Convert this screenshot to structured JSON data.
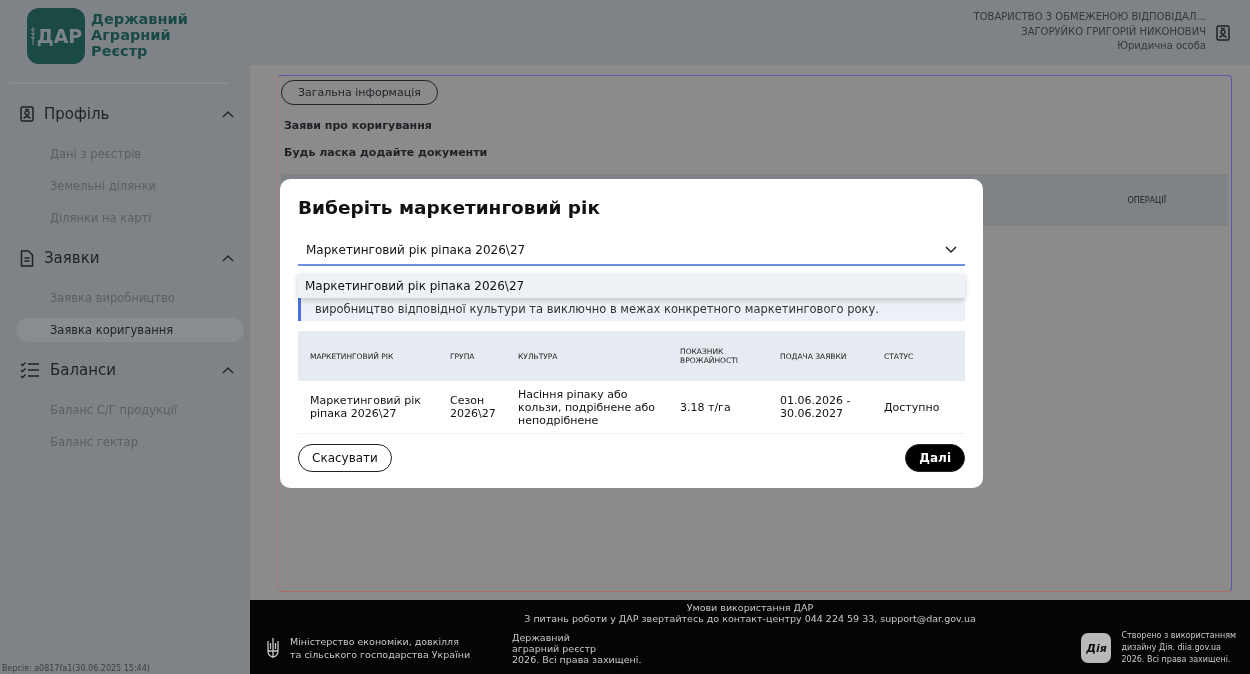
{
  "logo": {
    "mark": "ДАР",
    "lines": [
      "Державний",
      "Аграрний",
      "Реєстр"
    ]
  },
  "sidebar": {
    "sections": [
      {
        "title": "Профіль",
        "expanded": true,
        "items": [
          {
            "label": "Дані з реєстрів",
            "selected": false
          },
          {
            "label": "Земельні ділянки",
            "selected": false
          },
          {
            "label": "Ділянки на карті",
            "selected": false
          }
        ]
      },
      {
        "title": "Заявки",
        "expanded": true,
        "items": [
          {
            "label": "Заявка виробництво",
            "selected": false
          },
          {
            "label": "Заявка коригування",
            "selected": true
          }
        ]
      },
      {
        "title": "Баланси",
        "expanded": true,
        "items": [
          {
            "label": "Баланс С/Г продукції",
            "selected": false
          },
          {
            "label": "Баланс гектар",
            "selected": false
          }
        ]
      }
    ],
    "version": "Версія: a0817fa1(30.06.2025 15:44)"
  },
  "user": {
    "organization": "ТОВАРИСТВО З ОБМЕЖЕНОЮ ВІДПОВІДАЛ...",
    "name": "ЗАГОРУЙКО ГРИГОРІЙ НИКОНОВИЧ",
    "role": "Юридична особа"
  },
  "page": {
    "tab": "Загальна інформація",
    "heading": "Заяви про коригування",
    "subheading": "Будь ласка додайте документи",
    "table_column": "ОПЕРАЦІЇ"
  },
  "modal": {
    "title": "Виберіть маркетинговий рік",
    "select": {
      "value": "Маркетинговий рік ріпака 2026\\27",
      "expanded": true,
      "options": [
        {
          "label": "Маркетинговий рік ріпака 2026\\27",
          "selected": true
        }
      ]
    },
    "notice": "виробництво відповідної культури та виключно в межах конкретного маркетингового року.",
    "table": {
      "columns": [
        "МАРКЕТИНГОВИЙ РІК",
        "ГРУПА",
        "КУЛЬТУРА",
        "ПОКАЗНИК ВРОЖАЙНОСТІ",
        "ПОДАЧА ЗАЯВКИ",
        "СТАТУС"
      ],
      "rows": [
        [
          "Маркетинговий рік ріпака 2026\\27",
          "Сезон 2026\\27",
          "Насіння ріпаку або кользи, подрібнене або неподрібнене",
          "3.18 т/га",
          "01.06.2026 - 30.06.2027",
          "Доступно"
        ]
      ]
    },
    "cancel_button": "Скасувати",
    "next_button": "Далі"
  },
  "footer": {
    "terms": "Умови використання ДАР",
    "contact": "З питань роботи у ДАР звертайтесь до контакт-центру 044 224 59 33, support@dar.gov.ua",
    "ministry": [
      "Міністерство економіки, довкілля",
      "та сільського господарства України"
    ],
    "registry": [
      "Державний",
      "аграрний реєстр",
      "2026. Всі права захищені."
    ],
    "diia_logo": "Дія",
    "credit": [
      "Створено з використанням",
      "дизайну Дія. diia.gov.ua",
      "2026. Всі права захищені."
    ]
  }
}
